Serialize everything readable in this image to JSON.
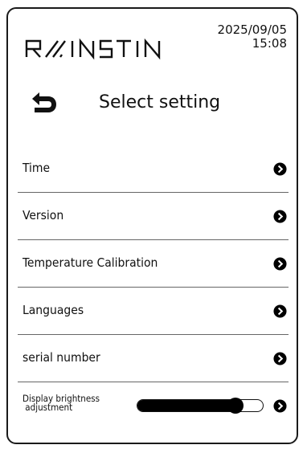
{
  "header": {
    "logo_text": "RAINSTIN",
    "date": "2025/09/05",
    "time": "15:08"
  },
  "page": {
    "title": "Select setting",
    "back_icon": "back-arrow-icon"
  },
  "menu": {
    "items": [
      {
        "label": "Time",
        "icon": "chevron-right-circle-icon"
      },
      {
        "label": "Version",
        "icon": "chevron-right-circle-icon"
      },
      {
        "label": "Temperature Calibration",
        "icon": "chevron-right-circle-icon"
      },
      {
        "label": "Languages",
        "icon": "chevron-right-circle-icon"
      },
      {
        "label": "serial number",
        "icon": "chevron-right-circle-icon"
      }
    ],
    "brightness": {
      "label_line1": "Display brightness",
      "label_line2": " adjustment",
      "level_percent": 78,
      "icon": "chevron-right-circle-icon"
    }
  },
  "colors": {
    "foreground": "#111111",
    "background": "#ffffff",
    "divider": "#666666"
  }
}
